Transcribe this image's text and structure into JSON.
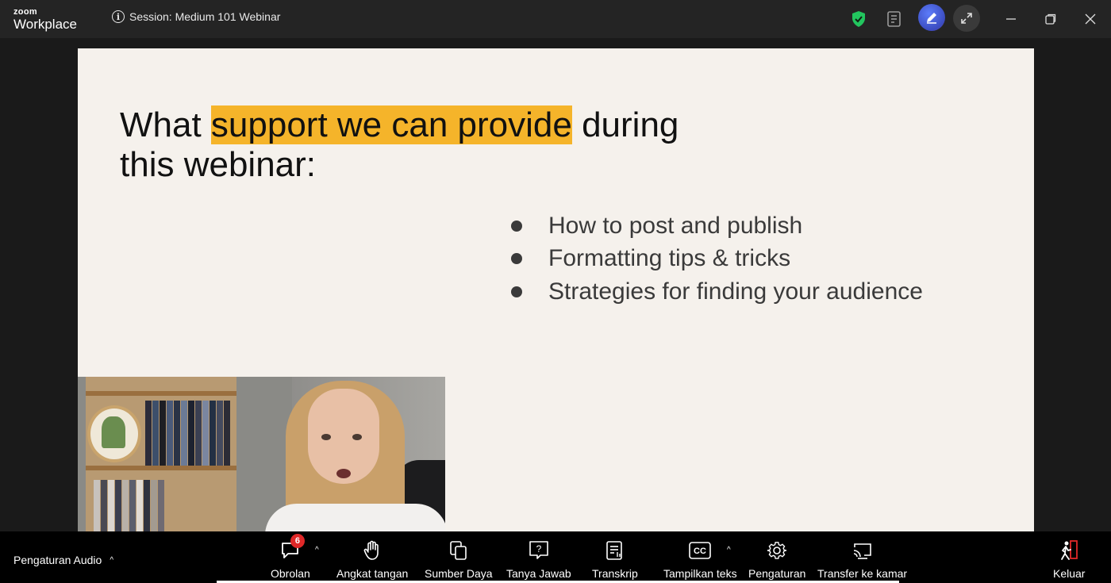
{
  "app": {
    "logo_top": "zoom",
    "logo_bottom": "Workplace",
    "session_title": "Session: Medium 101 Webinar"
  },
  "slide": {
    "title_pre": "What ",
    "title_highlight": "support we can provide",
    "title_post": " during",
    "title_line2": "this webinar:",
    "highlight_color": "#f5b42a",
    "bullets": [
      "How to post and publish",
      "Formatting tips & tricks",
      "Strategies for finding your audience"
    ]
  },
  "toolbar": {
    "audio_label": "Pengaturan Audio",
    "chat_label": "Obrolan",
    "chat_badge": "6",
    "raise_hand_label": "Angkat tangan",
    "resources_label": "Sumber Daya",
    "qa_label": "Tanya Jawab",
    "transcript_label": "Transkrip",
    "captions_label": "Tampilkan teks",
    "captions_icon_text": "CC",
    "settings_label": "Pengaturan",
    "transfer_label": "Transfer ke kamar",
    "leave_label": "Keluar",
    "qa_icon_text": "?"
  },
  "icons": {
    "shield": "shield-check-icon",
    "notes": "notes-icon",
    "annotate": "pencil-icon",
    "expand": "expand-icon",
    "minimize": "minimize-icon",
    "restore": "restore-icon",
    "close": "close-icon"
  },
  "colors": {
    "shield": "#22c55e",
    "badge": "#e02828",
    "leave_accent": "#e02828"
  }
}
